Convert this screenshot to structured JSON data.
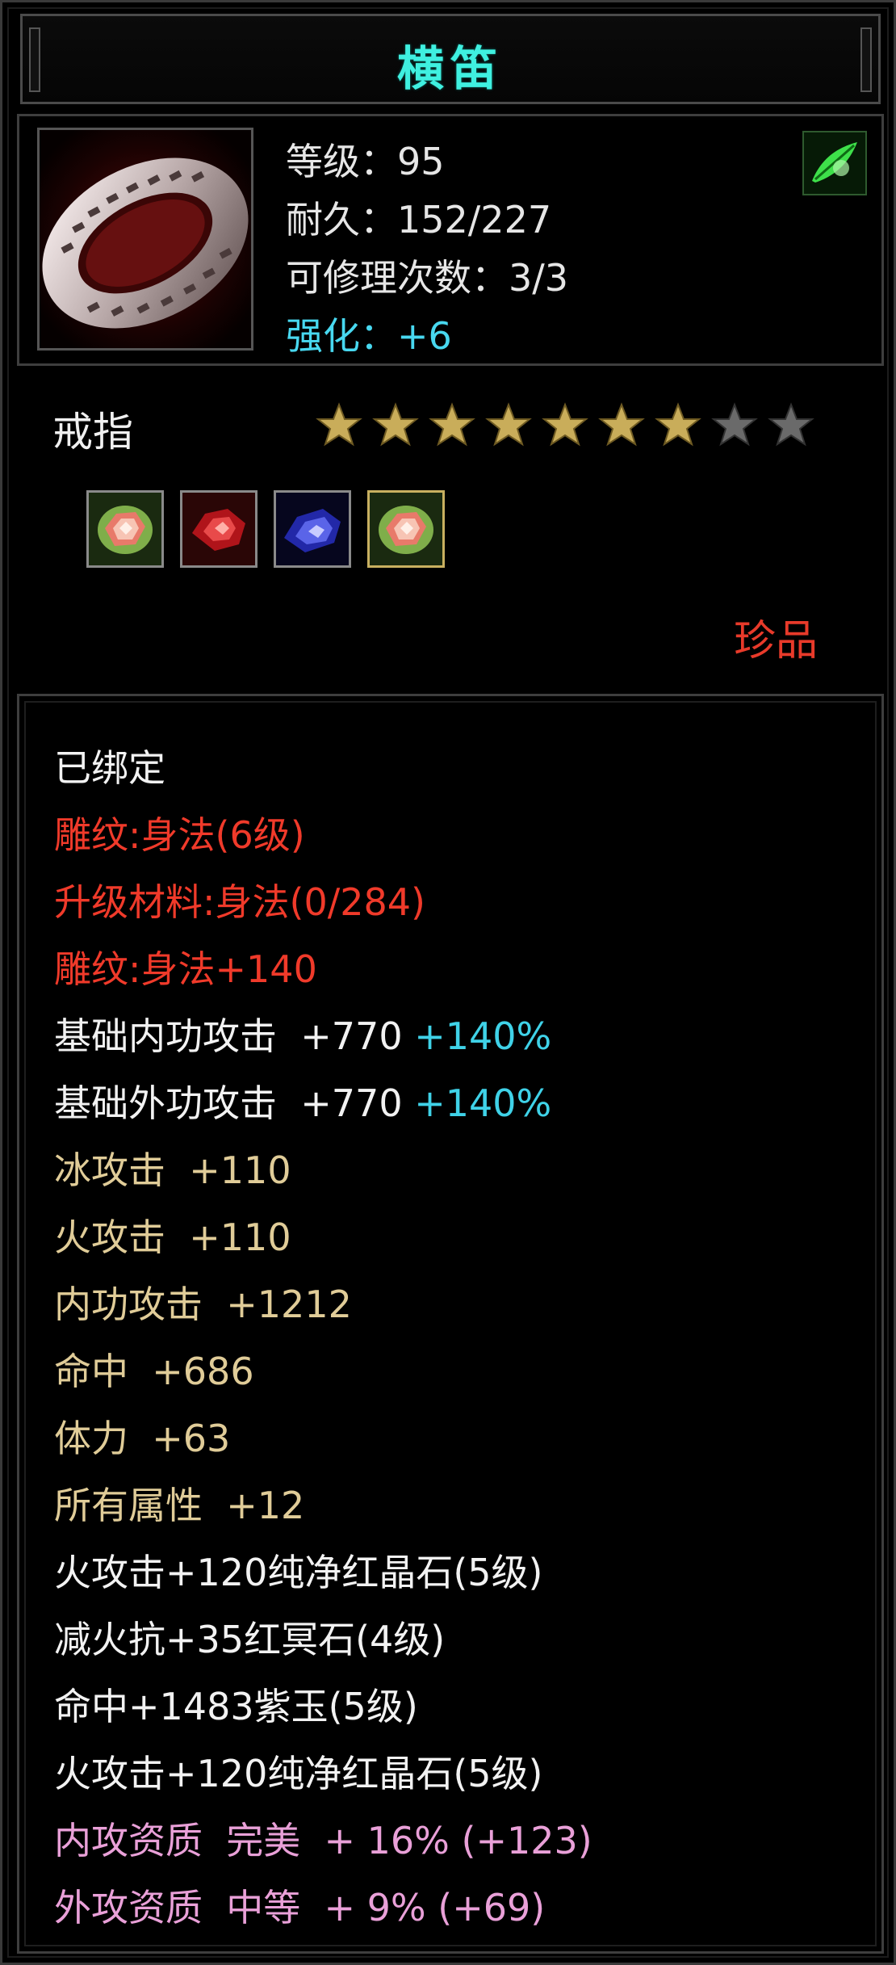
{
  "item": {
    "name": "横笛",
    "level_line": "等级：95",
    "durability_line": "耐久：152/227",
    "repair_line": "可修理次数：3/3",
    "enhance_line": "强化：+6",
    "type": "戒指",
    "stars_total": 9,
    "stars_filled": 7,
    "rarity": "珍品"
  },
  "gems": [
    {
      "name": "pure-red-crystal-icon"
    },
    {
      "name": "red-ming-stone-icon"
    },
    {
      "name": "purple-jade-icon"
    },
    {
      "name": "pure-red-crystal-icon"
    }
  ],
  "details": {
    "bound": "已绑定",
    "engrave_1": "雕纹:身法(6级)",
    "upgrade_material": "升级材料:身法(0/284)",
    "engrave_2": "雕纹:身法+140",
    "base_inner_label": "基础内功攻击  +770 ",
    "base_inner_pct": "+140%",
    "base_outer_label": "基础外功攻击  +770 ",
    "base_outer_pct": "+140%",
    "ice_attack": "冰攻击  +110",
    "fire_attack": "火攻击  +110",
    "inner_attack": "内功攻击  +1212",
    "accuracy": "命中  +686",
    "stamina": "体力  +63",
    "all_attributes": "所有属性  +12",
    "gem_line_1": "火攻击+120纯净红晶石(5级)",
    "gem_line_2": "减火抗+35红冥石(4级)",
    "gem_line_3": "命中+1483紫玉(5级)",
    "gem_line_4": "火攻击+120纯净红晶石(5级)",
    "inner_quality": "内攻资质  完美  + 16% (+123)",
    "outer_quality": "外攻资质  中等  + 9% (+69)"
  },
  "colors": {
    "title": "#3ff0e0",
    "enhance": "#48d8f0",
    "red": "#f03a2a",
    "gold": "#e0cc98",
    "pink": "#e9a0d8",
    "star_filled": "#c9ad5a",
    "star_empty": "#6a6a6a"
  }
}
